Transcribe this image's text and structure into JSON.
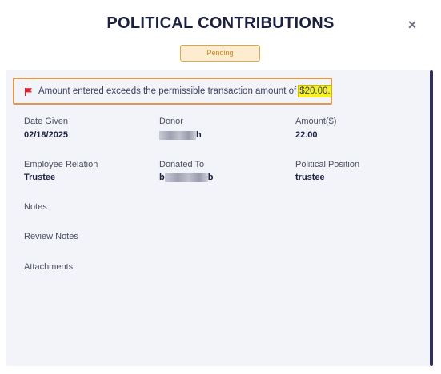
{
  "modal": {
    "title": "POLITICAL CONTRIBUTIONS",
    "close_icon": "close-icon",
    "status": "Pending"
  },
  "alert": {
    "icon": "flag-icon",
    "icon_color": "#e0202a",
    "message": "Amount entered exceeds the permissible transaction amount of",
    "limit": "$20.00."
  },
  "fields": {
    "date_given": {
      "label": "Date Given",
      "value": "02/18/2025"
    },
    "donor": {
      "label": "Donor",
      "value_start": "",
      "value_end": "h"
    },
    "amount": {
      "label": "Amount($)",
      "value": "22.00"
    },
    "employee_relation": {
      "label": "Employee Relation",
      "value": "Trustee"
    },
    "donated_to": {
      "label": "Donated To",
      "value_start": "b",
      "value_end": "b"
    },
    "political_position": {
      "label": "Political Position",
      "value": "trustee"
    },
    "notes": {
      "label": "Notes"
    },
    "review_notes": {
      "label": "Review Notes"
    },
    "attachments": {
      "label": "Attachments"
    }
  },
  "colors": {
    "pending_badge_bg": "#fdeccf",
    "pending_badge_border": "#e0a545",
    "alert_border": "#e0994c",
    "highlight": "#f6f02a",
    "panel_bg": "#f3f4f9"
  }
}
